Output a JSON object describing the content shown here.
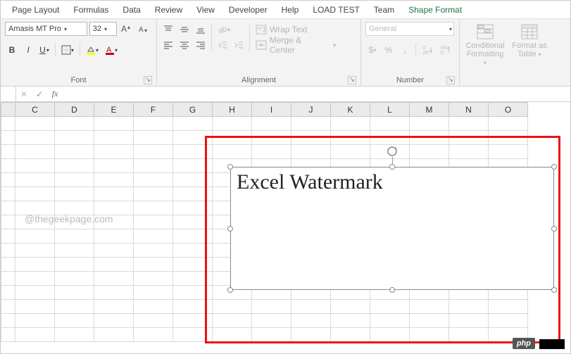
{
  "tabs": {
    "items": [
      {
        "label": "Page Layout"
      },
      {
        "label": "Formulas"
      },
      {
        "label": "Data"
      },
      {
        "label": "Review"
      },
      {
        "label": "View"
      },
      {
        "label": "Developer"
      },
      {
        "label": "Help"
      },
      {
        "label": "LOAD TEST"
      },
      {
        "label": "Team"
      },
      {
        "label": "Shape Format"
      }
    ],
    "active_index": 9
  },
  "ribbon": {
    "font": {
      "name": "Amasis MT Pro",
      "size": "32",
      "group_label": "Font"
    },
    "alignment": {
      "wrap_text": "Wrap Text",
      "merge_center": "Merge & Center",
      "group_label": "Alignment"
    },
    "number": {
      "format": "General",
      "group_label": "Number"
    },
    "styles": {
      "conditional_line1": "Conditional",
      "conditional_line2": "Formatting",
      "formatas_line1": "Format as",
      "formatas_line2": "Table"
    }
  },
  "formula_bar": {
    "value": ""
  },
  "columns": [
    "C",
    "D",
    "E",
    "F",
    "G",
    "H",
    "I",
    "J",
    "K",
    "L",
    "M",
    "N",
    "O"
  ],
  "shape": {
    "text": "Excel Watermark"
  },
  "watermark": "@thegeekpage.com",
  "badge": "php"
}
